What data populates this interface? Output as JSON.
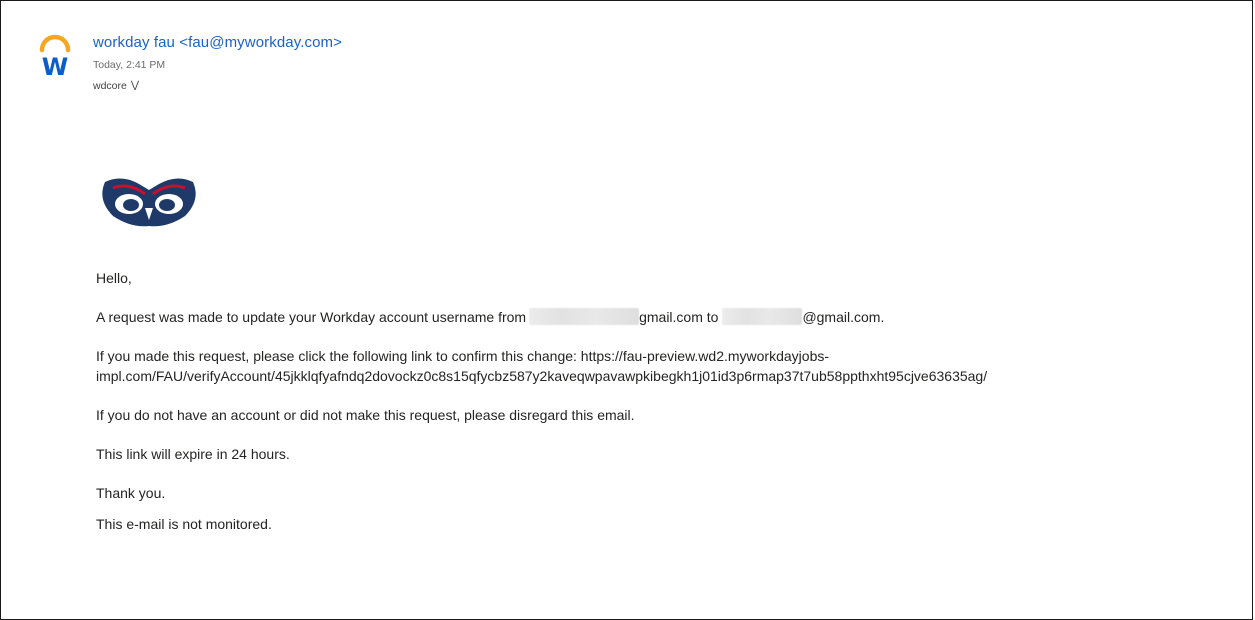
{
  "header": {
    "sender": "workday fau <fau@myworkday.com>",
    "time": "Today, 2:41 PM",
    "recipient": "wdcore",
    "expand_icon": "chevron-double-down-icon",
    "brand_colors": {
      "workday_orange": "#f5a623",
      "workday_blue": "#0b5ec9"
    }
  },
  "body": {
    "greeting": "Hello,",
    "request_prefix": "A request was made to update your Workday account username from",
    "request_from_suffix": "gmail.com to",
    "request_to_suffix": "@gmail.com.",
    "link_prefix": "If you made this request, please click the following link to confirm this change: https://fau-preview.wd2.myworkdayjobs-",
    "link_continuation": "impl.com/FAU/verifyAccount/45jkklqfyafndq2dovockz0c8s15qfycbz587y2kaveqwpavawpkibegkh1j01id3p6rmap37t7ub58ppthxht95cjve63635ag/",
    "disregard": "If you do not have an account or did not make this request, please disregard this email.",
    "expiry": "This link will expire in 24 hours.",
    "thanks": "Thank you.",
    "not_monitored": "This e-mail is not monitored."
  },
  "logo": {
    "name": "fau-owl-logo",
    "colors": {
      "navy": "#1f3a68",
      "red": "#c8102e",
      "white": "#ffffff"
    }
  }
}
